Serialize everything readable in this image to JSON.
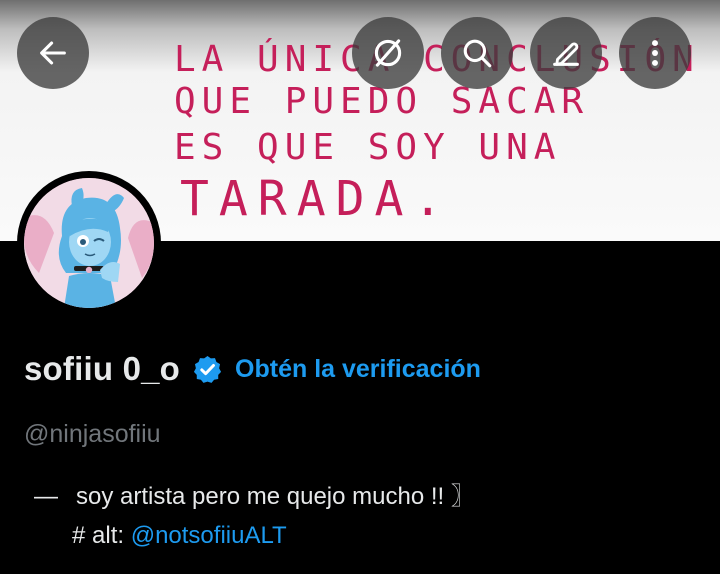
{
  "header": {
    "banner_lines": [
      "La única conclusión",
      "que puedo sacar",
      "es que soy   una",
      "tarada."
    ],
    "buttons": [
      {
        "name": "back",
        "icon": "arrow-left-icon"
      },
      {
        "name": "hide",
        "icon": "eye-off-icon"
      },
      {
        "name": "search",
        "icon": "search-icon"
      },
      {
        "name": "edit",
        "icon": "pencil-icon"
      },
      {
        "name": "more",
        "icon": "more-vertical-icon"
      }
    ]
  },
  "profile": {
    "display_name": "sofiiu 0_o",
    "verified_badge_icon": "verified-badge-icon",
    "get_verified_label": "Obtén la verificación",
    "handle": "@ninjasofiiu",
    "bio": {
      "line1_prefix": "—",
      "line1_text": "soy artista pero me quejo mucho  !!  〗",
      "line2_text": "# alt: ",
      "line2_link": "@notsofiiuALT"
    }
  },
  "colors": {
    "background": "#000000",
    "accent_blue": "#1d9bf0",
    "text_primary": "#e7e9ea",
    "text_secondary": "#71767b",
    "banner_ink": "#c51f5a"
  }
}
